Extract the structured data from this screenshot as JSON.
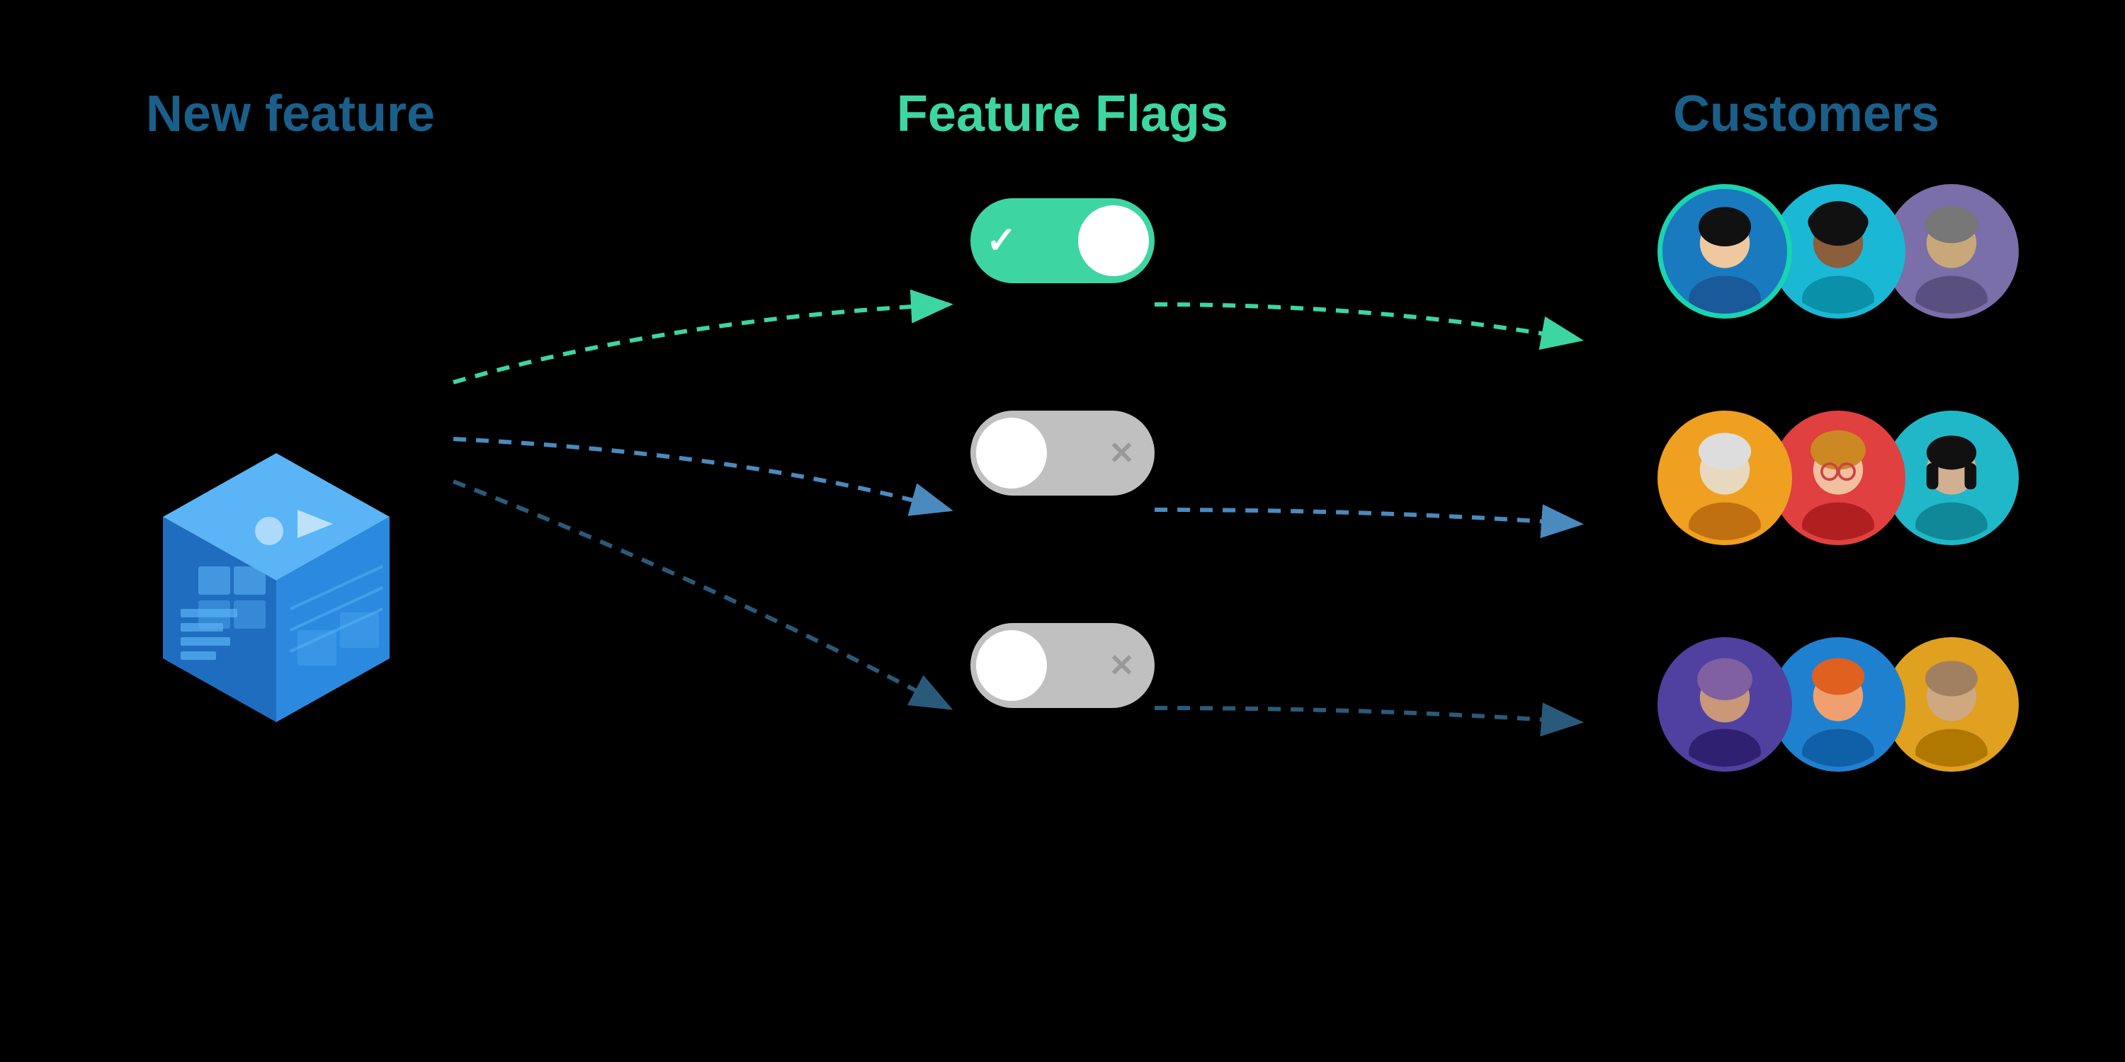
{
  "headers": {
    "new_feature": "New feature",
    "feature_flags": "Feature Flags",
    "customers": "Customers"
  },
  "toggles": [
    {
      "state": "on",
      "icon": "✓"
    },
    {
      "state": "off",
      "icon": "✕"
    },
    {
      "state": "off",
      "icon": "✕"
    }
  ],
  "avatar_groups": [
    {
      "avatars": [
        {
          "bg": "#1a7abf",
          "border": "#1ad4b0",
          "skin": "#f0c8a0",
          "hair": "#1a1a2e",
          "hair_color": "#111"
        },
        {
          "bg": "#1ab8d4",
          "border": "#1ab8d4",
          "skin": "#8B5E3C",
          "hair": "#111",
          "hair_color": "#111"
        },
        {
          "bg": "#7a6fa8",
          "border": "#7a6fa8",
          "skin": "#c8a87a",
          "hair": "#555",
          "hair_color": "#555"
        }
      ]
    },
    {
      "avatars": [
        {
          "bg": "#f0a020",
          "border": "#f0a020",
          "skin": "#e8d8c0",
          "hair": "#ddd",
          "hair_color": "#ddd"
        },
        {
          "bg": "#e04040",
          "border": "#e04040",
          "skin": "#f0c0a0",
          "hair": "#cc8822",
          "hair_color": "#cc8822"
        },
        {
          "bg": "#20b8c8",
          "border": "#20b8c8",
          "skin": "#d0b090",
          "hair": "#1a1a2e",
          "hair_color": "#111"
        }
      ]
    },
    {
      "avatars": [
        {
          "bg": "#5040a0",
          "border": "#5040a0",
          "skin": "#c89878",
          "hair": "#8060a0",
          "hair_color": "#8060a0"
        },
        {
          "bg": "#2080d0",
          "border": "#2080d0",
          "skin": "#f0a070",
          "hair": "#e06020",
          "hair_color": "#e06020"
        },
        {
          "bg": "#e0a020",
          "border": "#e0a020",
          "skin": "#d0a880",
          "hair": "#a08060",
          "hair_color": "#a08060"
        }
      ]
    }
  ],
  "colors": {
    "bg": "#000000",
    "toggle_on": "#3dd6a3",
    "toggle_off": "#c0c0c0",
    "dotted_green": "#3dd6a3",
    "dotted_blue": "#4a8abf",
    "dotted_dark_blue": "#2a5a8a",
    "header_blue": "#1a5f8a",
    "header_green": "#3dd6a3"
  }
}
